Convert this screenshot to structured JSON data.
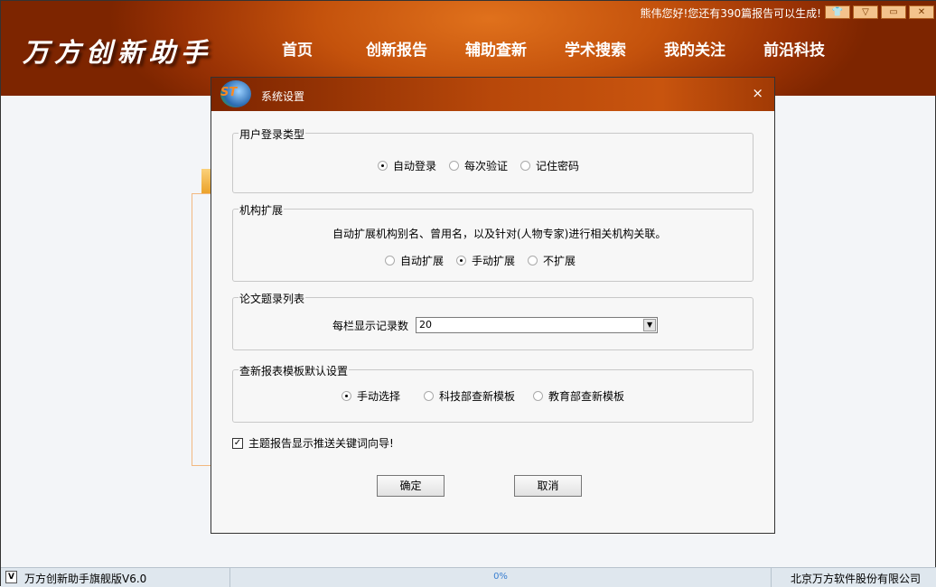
{
  "app": {
    "logo": "万方创新助手",
    "greeting": "熊伟您好!您还有390篇报告可以生成!",
    "nav": [
      "首页",
      "创新报告",
      "辅助查新",
      "学术搜索",
      "我的关注",
      "前沿科技"
    ],
    "window_buttons": [
      "shirt-icon",
      "dropdown-icon",
      "minimize-icon",
      "close-icon"
    ]
  },
  "dialog": {
    "title": "系统设置",
    "close": "×",
    "login": {
      "legend": "用户登录类型",
      "options": [
        "自动登录",
        "每次验证",
        "记住密码"
      ],
      "selected": 0
    },
    "org": {
      "legend": "机构扩展",
      "desc": "自动扩展机构别名、曾用名，以及针对(人物专家)进行相关机构关联。",
      "options": [
        "自动扩展",
        "手动扩展",
        "不扩展"
      ],
      "selected": 1
    },
    "list": {
      "legend": "论文题录列表",
      "label": "每栏显示记录数",
      "value": "20"
    },
    "template": {
      "legend": "查新报表模板默认设置",
      "options": [
        "手动选择",
        "科技部查新模板",
        "教育部查新模板"
      ],
      "selected": 0
    },
    "checkbox": {
      "label": "主题报告显示推送关键词向导!",
      "checked": true
    },
    "ok": "确定",
    "cancel": "取消"
  },
  "status": {
    "v": "V",
    "name": "万方创新助手",
    "edition": "旗舰版V6.0",
    "progress": "0%",
    "company": "北京万方软件股份有限公司"
  },
  "colors": {
    "header": "#c4520c",
    "accent": "#3a7fd0"
  }
}
